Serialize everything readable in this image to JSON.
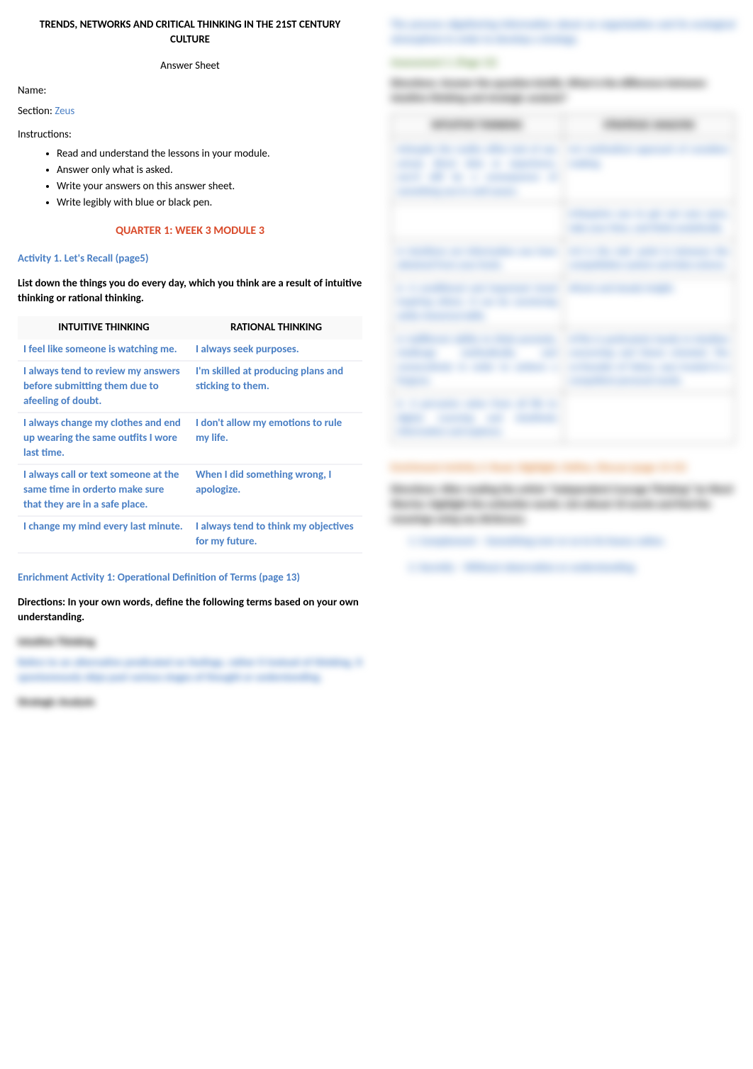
{
  "header": {
    "title": "TRENDS, NETWORKS AND CRITICAL THINKING IN THE 21ST CENTURY CULTURE",
    "subtitle": "Answer Sheet"
  },
  "name": {
    "label": "Name:"
  },
  "section": {
    "label": "Section:",
    "value": "Zeus"
  },
  "instructions": {
    "label": "Instructions:",
    "items": [
      "Read and understand the lessons in your module.",
      "Answer only what is asked.",
      "Write your answers on this answer sheet.",
      "Write legibly with blue or black pen."
    ]
  },
  "quarter": "QUARTER 1: WEEK 3 MODULE 3",
  "activity1": {
    "heading": "Activity 1. Let's Recall (page5)",
    "directions": "List down the things you do every day, which you think are a result of intuitive thinking or rational thinking.",
    "col1": "INTUITIVE THINKING",
    "col2": "RATIONAL THINKING",
    "rows": [
      {
        "l": "I feel like someone is watching me.",
        "r": "I always seek purposes."
      },
      {
        "l": "I always tend to review my answers before submitting them due to afeeling of doubt.",
        "r": "I'm skilled at producing plans and sticking to them."
      },
      {
        "l": "I always change my clothes and end up wearing the same outfits I wore last time.",
        "r": "I don't allow my emotions to rule my life."
      },
      {
        "l": "I always call or text someone at the same time in orderto make sure that they are in a safe place.",
        "r": "When I did something wrong, I apologize."
      },
      {
        "l": "I change my mind every last minute.",
        "r": "I always tend to think my objectives for my future."
      }
    ]
  },
  "enrichment1": {
    "heading": "Enrichment Activity 1: Operational Definition of Terms (page 13)",
    "directions": "Directions: In your own words, define the following terms based on your own understanding.",
    "terms": [
      {
        "title": "Intuitive Thinking",
        "body": "Refers to an alternative predicated on feelings, rather II Instead of thinking, it spontaneously skips past various stages of thought or understanding."
      },
      {
        "title": "Strategic Analysis",
        "body": "The process ofgathering information about an organization and its ecological atmosphere in order to develop a strategy."
      }
    ]
  },
  "assessment1": {
    "heading": "Assessment 1: (Page 13)",
    "directions": "Directions: Answer the question briefly. What is the difference between intuitive thinking and strategic analysis?",
    "col1": "INTUITIVE THINKING",
    "col2": "STRATEGIC ANALYSIS",
    "rows": [
      {
        "l": "●Despite the reality ofthe lack of any actual, direct data or experience, you'd still be a consequence of something you're well aware.",
        "r": "●A methodical approach of considers making."
      },
      {
        "l": "",
        "r": "●Requires you to get out your pens, take your time, and think analytically."
      },
      {
        "l": "● Intuitions are information you have obtained from your brain.",
        "r": "●It is the mid- point in between the compellation system and data science."
      },
      {
        "l": "● A conditional and important trend inspiring others. It can be convincing while rhetorical skills.",
        "r": "●Facts and steady insight."
      },
      {
        "l": "● Indifferent ability to think precisely, challenge methodically, and consecutively in order to achieve a forgone.",
        "r": "●This is particularly handy in intuition concerning and future oriented. The co-founder of Yahoo, says trusted in a compellent personal needs."
      },
      {
        "l": "● A pervasive solon from all life to digital. Learning and intuitively information and explores.",
        "r": ""
      }
    ]
  },
  "enrichment2": {
    "heading": "Enrichment Activity 2: Read, Highlight, Define, Discuss (page 13-15)",
    "directions": "Directions: After reading the article \"Independent Courage Thinking\" by Word Warrior, highlight the unfamilar words. List atleast 10 words and find the meanings using any dictionary.",
    "items": [
      "Complement – Something over or so to its heavy cation.",
      "Secretly – Without observation or understanding."
    ]
  }
}
